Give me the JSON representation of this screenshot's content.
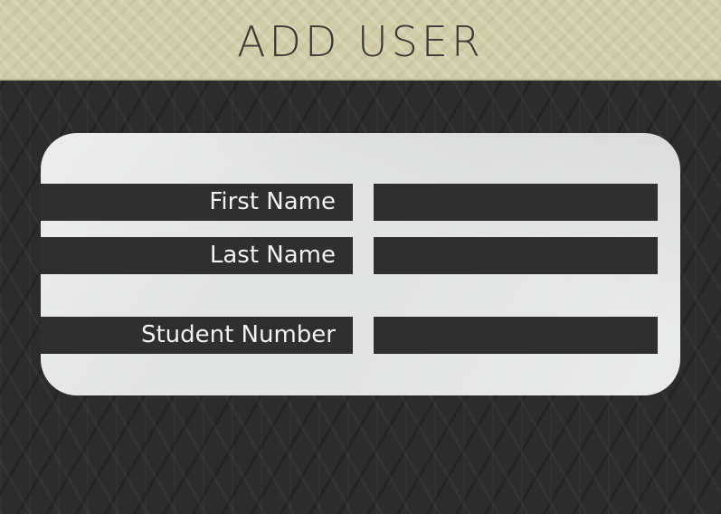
{
  "header": {
    "title": "ADD USER"
  },
  "form": {
    "fields": [
      {
        "label": "First Name",
        "value": "",
        "placeholder": ""
      },
      {
        "label": "Last Name",
        "value": "",
        "placeholder": ""
      },
      {
        "label": "Student Number",
        "value": "",
        "placeholder": ""
      }
    ]
  },
  "colors": {
    "header_background": "#d0cda8",
    "page_background": "#2c2c2c",
    "panel_background": "#e3e4e4",
    "field_background": "#2f2f2f",
    "field_text": "#f2f2f2",
    "title_text": "#3a3a36"
  }
}
